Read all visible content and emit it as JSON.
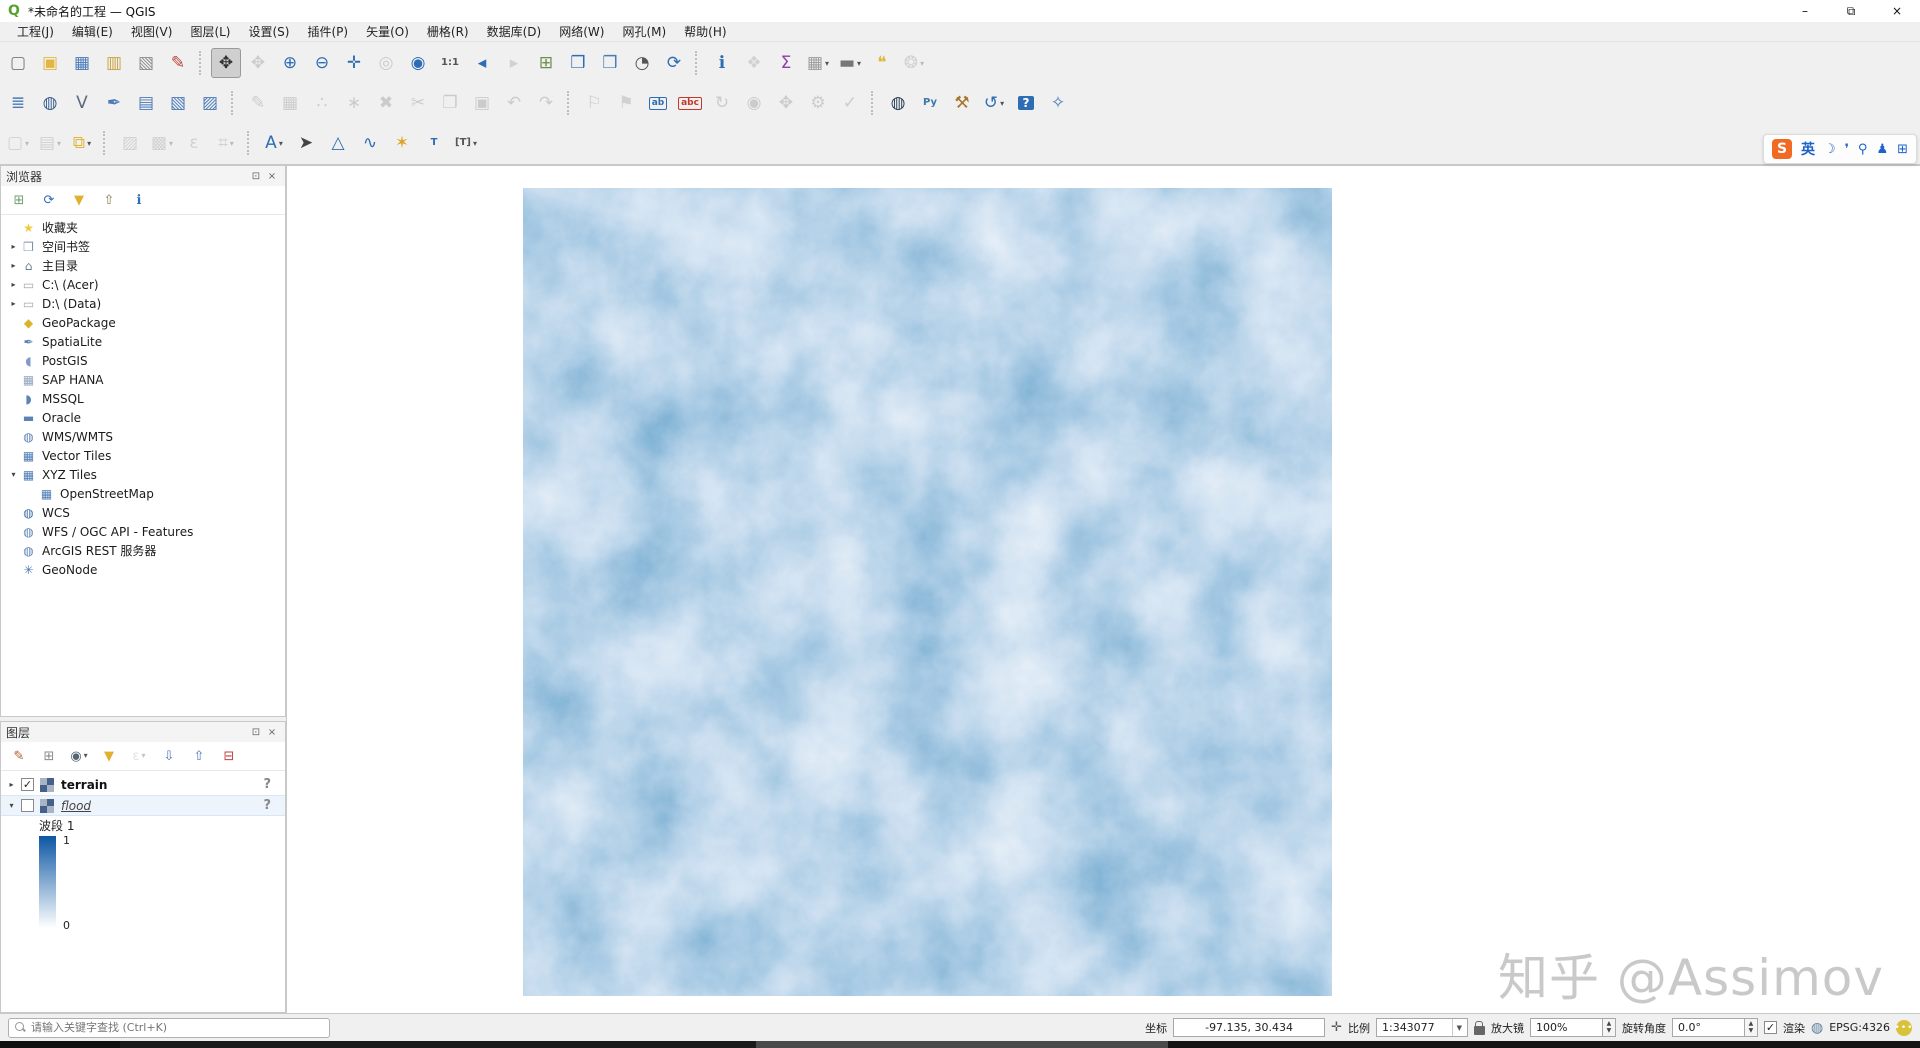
{
  "window": {
    "title": "*未命名的工程 — QGIS",
    "logo": "Q",
    "controls": [
      {
        "n": "minimize-button",
        "g": "–"
      },
      {
        "n": "restore-button",
        "g": "⧉"
      },
      {
        "n": "close-button",
        "g": "×"
      }
    ]
  },
  "menubar": {
    "items": [
      {
        "id": "project",
        "label": "工程(J)"
      },
      {
        "id": "edit",
        "label": "编辑(E)"
      },
      {
        "id": "view",
        "label": "视图(V)"
      },
      {
        "id": "layer",
        "label": "图层(L)"
      },
      {
        "id": "settings",
        "label": "设置(S)"
      },
      {
        "id": "plugins",
        "label": "插件(P)"
      },
      {
        "id": "vector",
        "label": "矢量(O)"
      },
      {
        "id": "raster",
        "label": "栅格(R)"
      },
      {
        "id": "database",
        "label": "数据库(D)"
      },
      {
        "id": "web",
        "label": "网络(W)"
      },
      {
        "id": "mesh",
        "label": "网孔(M)"
      },
      {
        "id": "help",
        "label": "帮助(H)"
      }
    ]
  },
  "toolbars": {
    "rows": [
      [
        {
          "n": "new-project",
          "g": "▢",
          "c": "#777777"
        },
        {
          "n": "open-project",
          "g": "▣",
          "c": "#e3b642"
        },
        {
          "n": "save-project",
          "g": "▦",
          "c": "#4a7ab8"
        },
        {
          "n": "new-print-layout",
          "g": "▥",
          "c": "#c9a23e"
        },
        {
          "n": "show-layout-manager",
          "g": "▧",
          "c": "#8a8a8a"
        },
        {
          "n": "style-manager",
          "g": "✎",
          "c": "#b8443a"
        },
        {
          "sep": true
        },
        {
          "n": "pan-map",
          "g": "✥",
          "c": "#333333",
          "sel": true
        },
        {
          "n": "pan-to-selection",
          "g": "✥",
          "c": "#888888",
          "dis": true
        },
        {
          "n": "zoom-in",
          "g": "⊕",
          "c": "#2e6db4"
        },
        {
          "n": "zoom-out",
          "g": "⊖",
          "c": "#2e6db4"
        },
        {
          "n": "zoom-full",
          "g": "✛",
          "c": "#2e6db4"
        },
        {
          "n": "zoom-to-selection",
          "g": "◎",
          "c": "#888888",
          "dis": true
        },
        {
          "n": "zoom-to-layer",
          "g": "◉",
          "c": "#2e6db4"
        },
        {
          "n": "zoom-native-resolution",
          "g": "1:1",
          "c": "#555555",
          "t": true
        },
        {
          "n": "zoom-last",
          "g": "◂",
          "c": "#2e6db4"
        },
        {
          "n": "zoom-next",
          "g": "▸",
          "c": "#999999",
          "dis": true
        },
        {
          "n": "new-map-view",
          "g": "⊞",
          "c": "#6f8f4f"
        },
        {
          "n": "new-spatial-bookmark",
          "g": "❒",
          "c": "#2e6db4"
        },
        {
          "n": "show-spatial-bookmarks",
          "g": "❒",
          "c": "#4a7ab8"
        },
        {
          "n": "temporal-controller",
          "g": "◔",
          "c": "#555555"
        },
        {
          "n": "refresh-map",
          "g": "⟳",
          "c": "#2e6db4"
        },
        {
          "sep": true
        },
        {
          "n": "identify-features",
          "g": "ℹ",
          "c": "#2e6db4"
        },
        {
          "n": "run-feature-action",
          "g": "❖",
          "c": "#999999",
          "dis": true
        },
        {
          "n": "show-statistical-summary",
          "g": "Σ",
          "c": "#8e3fa8"
        },
        {
          "n": "open-attribute-table",
          "g": "▦",
          "c": "#9a9a9a",
          "dd": true
        },
        {
          "n": "measure-line",
          "g": "▬",
          "c": "#777777",
          "dd": true
        },
        {
          "n": "map-tips",
          "g": "❝",
          "c": "#e0b63a"
        },
        {
          "n": "new-annotation",
          "g": "❂",
          "c": "#999999",
          "dis": true,
          "dd": true
        }
      ],
      [
        {
          "n": "open-data-source-manager",
          "g": "≣",
          "c": "#4a7ab8"
        },
        {
          "n": "new-geopackage-layer",
          "g": "◍",
          "c": "#3a5f8f"
        },
        {
          "n": "new-shapefile-layer",
          "g": "V",
          "c": "#5b6b7b"
        },
        {
          "n": "new-spatialite-layer",
          "g": "✒",
          "c": "#4a7ab8"
        },
        {
          "n": "new-virtual-layer",
          "g": "▤",
          "c": "#4a7ab8"
        },
        {
          "n": "new-mesh-layer",
          "g": "▧",
          "c": "#4a7ab8"
        },
        {
          "n": "new-temporary-scratch-layer",
          "g": "▨",
          "c": "#4a7ab8"
        },
        {
          "sep": true
        },
        {
          "n": "toggle-editing",
          "g": "✎",
          "c": "#888888",
          "dis": true
        },
        {
          "n": "save-layer-edits",
          "g": "▦",
          "c": "#888888",
          "dis": true
        },
        {
          "n": "add-feature",
          "g": "∴",
          "c": "#888888",
          "dis": true
        },
        {
          "n": "vertex-tool",
          "g": "∗",
          "c": "#888888",
          "dis": true
        },
        {
          "n": "delete-selected",
          "g": "✖",
          "c": "#888888",
          "dis": true
        },
        {
          "n": "cut-features",
          "g": "✂",
          "c": "#888888",
          "dis": true
        },
        {
          "n": "copy-features",
          "g": "❐",
          "c": "#888888",
          "dis": true
        },
        {
          "n": "paste-features",
          "g": "▣",
          "c": "#888888",
          "dis": true
        },
        {
          "n": "undo",
          "g": "↶",
          "c": "#888888",
          "dis": true
        },
        {
          "n": "redo",
          "g": "↷",
          "c": "#888888",
          "dis": true
        },
        {
          "sep": true
        },
        {
          "n": "pin-labels",
          "g": "⚐",
          "c": "#888888",
          "dis": true
        },
        {
          "n": "highlight-pinned-labels",
          "g": "⚑",
          "c": "#999999",
          "dis": true
        },
        {
          "n": "move-label",
          "g": "ab",
          "c": "#2e6db4",
          "t": true,
          "box": "blueline"
        },
        {
          "n": "change-label",
          "g": "abc",
          "c": "#c0392b",
          "t": true,
          "box": "red"
        },
        {
          "n": "rotate-label",
          "g": "↻",
          "c": "#888888",
          "dis": true
        },
        {
          "n": "show-hide-labels",
          "g": "◉",
          "c": "#888888",
          "dis": true
        },
        {
          "n": "move-label-diagram",
          "g": "✥",
          "c": "#888888",
          "dis": true
        },
        {
          "n": "label-properties",
          "g": "⚙",
          "c": "#888888",
          "dis": true
        },
        {
          "n": "diagram-properties",
          "g": "✓",
          "c": "#888888",
          "dis": true
        },
        {
          "sep": true
        },
        {
          "n": "osm-place-search",
          "g": "◍",
          "c": "#2a3f55"
        },
        {
          "n": "python-console",
          "g": "Py",
          "c": "#3c78aa",
          "t": true
        },
        {
          "n": "processing-toolbox",
          "g": "⚒",
          "c": "#a8762a"
        },
        {
          "n": "processing-history",
          "g": "↺",
          "c": "#2e6db4",
          "dd": true
        },
        {
          "n": "help-contents",
          "g": "?",
          "c": "#ffffff",
          "t": true,
          "box": "bluefill"
        },
        {
          "n": "georeferencer",
          "g": "✧",
          "c": "#4a7ab8"
        }
      ],
      [
        {
          "n": "select-features",
          "g": "▢",
          "c": "#999999",
          "dis": true,
          "dd": true
        },
        {
          "n": "select-by-value",
          "g": "▤",
          "c": "#999999",
          "dis": true,
          "dd": true
        },
        {
          "n": "deselect-all",
          "g": "⧉",
          "c": "#e0b63a",
          "dd": true
        },
        {
          "sep": true
        },
        {
          "n": "field-calculator",
          "g": "▨",
          "c": "#999999",
          "dis": true
        },
        {
          "n": "multi-edit-attributes",
          "g": "▩",
          "c": "#999999",
          "dis": true,
          "dd": true
        },
        {
          "n": "edit-metadata",
          "g": "ε",
          "c": "#999999",
          "dis": true
        },
        {
          "n": "raster-tools",
          "g": "⌗",
          "c": "#999999",
          "dis": true,
          "dd": true
        },
        {
          "sep": true
        },
        {
          "n": "layer-labeling-options",
          "g": "A",
          "c": "#2e6db4",
          "dd": true
        },
        {
          "n": "move-annotation-tool",
          "g": "➤",
          "c": "#444444"
        },
        {
          "n": "new-polygon-annotation",
          "g": "△",
          "c": "#2e6db4"
        },
        {
          "n": "new-line-annotation",
          "g": "∿",
          "c": "#2e6db4"
        },
        {
          "n": "new-marker-annotation",
          "g": "✶",
          "c": "#d9a62a"
        },
        {
          "n": "new-text-annotation",
          "g": "T",
          "c": "#2e6db4",
          "t": true
        },
        {
          "n": "balloon-text-annotation",
          "g": "[T]",
          "c": "#555555",
          "t": true,
          "dd": true
        }
      ]
    ]
  },
  "browser_panel": {
    "title": "浏览器",
    "toolbar": [
      {
        "n": "add-selected-layers",
        "g": "⊞",
        "c": "#6f9f6f"
      },
      {
        "n": "refresh-browser",
        "g": "⟳",
        "c": "#2e6db4"
      },
      {
        "n": "filter-browser",
        "g": "▼",
        "c": "#e0b030"
      },
      {
        "n": "collapse-all",
        "g": "⇧",
        "c": "#8a7a4a"
      },
      {
        "n": "show-properties-widget",
        "g": "ℹ",
        "c": "#2e6db4"
      }
    ],
    "tree": [
      {
        "id": "favorites",
        "label": "收藏夹",
        "icon": "star-icon",
        "g": "★",
        "c": "#f3c93c",
        "arrow": ""
      },
      {
        "id": "spatial-bookmarks",
        "label": "空间书签",
        "icon": "bookmark-icon",
        "g": "❒",
        "c": "#7d93ad",
        "arrow": "▸"
      },
      {
        "id": "home",
        "label": "主目录",
        "icon": "home-icon",
        "g": "⌂",
        "c": "#6b7f95",
        "arrow": "▸"
      },
      {
        "id": "drive-c",
        "label": "C:\\ (Acer)",
        "icon": "folder-icon",
        "g": "▭",
        "c": "#a8a8a8",
        "arrow": "▸"
      },
      {
        "id": "drive-d",
        "label": "D:\\ (Data)",
        "icon": "folder-icon",
        "g": "▭",
        "c": "#a8a8a8",
        "arrow": "▸"
      },
      {
        "id": "geopackage",
        "label": "GeoPackage",
        "icon": "geopackage-icon",
        "g": "◆",
        "c": "#d9b32a",
        "arrow": ""
      },
      {
        "id": "spatialite",
        "label": "SpatiaLite",
        "icon": "spatialite-icon",
        "g": "✒",
        "c": "#5b84b5",
        "arrow": ""
      },
      {
        "id": "postgis",
        "label": "PostGIS",
        "icon": "postgis-icon",
        "g": "◖",
        "c": "#7d9cc9",
        "arrow": ""
      },
      {
        "id": "sap-hana",
        "label": "SAP HANA",
        "icon": "sap-hana-icon",
        "g": "▦",
        "c": "#8fa5bd",
        "arrow": ""
      },
      {
        "id": "mssql",
        "label": "MSSQL",
        "icon": "mssql-icon",
        "g": "◗",
        "c": "#5b84b5",
        "arrow": ""
      },
      {
        "id": "oracle",
        "label": "Oracle",
        "icon": "oracle-icon",
        "g": "▬",
        "c": "#5b84b5",
        "arrow": ""
      },
      {
        "id": "wms-wmts",
        "label": "WMS/WMTS",
        "icon": "globe-icon",
        "g": "◍",
        "c": "#5b84b5",
        "arrow": ""
      },
      {
        "id": "vector-tiles",
        "label": "Vector Tiles",
        "icon": "tiles-icon",
        "g": "▦",
        "c": "#4a7ab5",
        "arrow": ""
      },
      {
        "id": "xyz-tiles",
        "label": "XYZ Tiles",
        "icon": "tiles-icon",
        "g": "▦",
        "c": "#4a7ab5",
        "arrow": "▾"
      },
      {
        "id": "openstreetmap",
        "label": "OpenStreetMap",
        "icon": "tiles-icon",
        "g": "▦",
        "c": "#4a7ab5",
        "arrow": "",
        "indent": 1
      },
      {
        "id": "wcs",
        "label": "WCS",
        "icon": "globe-icon",
        "g": "◍",
        "c": "#3d6fa8",
        "arrow": ""
      },
      {
        "id": "wfs",
        "label": "WFS / OGC API - Features",
        "icon": "globe-icon",
        "g": "◍",
        "c": "#5b84b5",
        "arrow": ""
      },
      {
        "id": "arcgis-rest",
        "label": "ArcGIS REST 服务器",
        "icon": "globe-icon",
        "g": "◍",
        "c": "#5b84b5",
        "arrow": ""
      },
      {
        "id": "geonode",
        "label": "GeoNode",
        "icon": "geonode-icon",
        "g": "✳",
        "c": "#4a7ab5",
        "arrow": ""
      }
    ]
  },
  "layers_panel": {
    "title": "图层",
    "toolbar": [
      {
        "n": "open-layer-styling-panel",
        "g": "✎",
        "c": "#b05a2a"
      },
      {
        "n": "add-group",
        "g": "⊞",
        "c": "#8a8a8a"
      },
      {
        "n": "manage-map-themes",
        "g": "◉",
        "c": "#556677",
        "dd": true
      },
      {
        "n": "filter-legend",
        "g": "▼",
        "c": "#e0b030"
      },
      {
        "n": "filter-by-expression",
        "g": "ε",
        "c": "#aaaaaa",
        "dis": true,
        "dd": true
      },
      {
        "n": "expand-all",
        "g": "⇩",
        "c": "#4a7ab8"
      },
      {
        "n": "collapse-all-layers",
        "g": "⇧",
        "c": "#4a7ab8"
      },
      {
        "n": "remove-layer",
        "g": "⊟",
        "c": "#c04040"
      }
    ],
    "layers": [
      {
        "id": "terrain",
        "name": "terrain",
        "checked": true,
        "bold": true,
        "arrow": "▸",
        "badge": "?"
      },
      {
        "id": "flood",
        "name": "flood",
        "checked": false,
        "italic": true,
        "selected": true,
        "arrow": "▾",
        "badge": "?"
      }
    ],
    "legend": {
      "band": "波段 1",
      "max": "1",
      "min": "0",
      "top_color": "#0d57a3",
      "bottom_color": "#ffffff"
    }
  },
  "statusbar": {
    "search_placeholder": "请输入关键字查找 (Ctrl+K)",
    "coord_label": "坐标",
    "coord_value": "-97.135, 30.434",
    "scale_label": "比例",
    "scale_value": "1:343077",
    "magnifier_label": "放大镜",
    "magnifier_value": "100%",
    "rotation_label": "旋转角度",
    "rotation_value": "0.0°",
    "render_label": "渲染",
    "crs": "EPSG:4326"
  },
  "map": {
    "background": "#ffffff",
    "palette": {
      "r": "0.07 0.20 0.40 0.62 0.80 0.91",
      "g": "0.29 0.44 0.60 0.75 0.87 0.94",
      "b": "0.52 0.66 0.78 0.88 0.94 0.97"
    }
  },
  "watermark": {
    "text": "知乎 @Assimov"
  },
  "input_method": {
    "logo": "S",
    "mode": "英",
    "icons": [
      {
        "n": "night-mode-icon",
        "g": "☽"
      },
      {
        "n": "punctuation-icon",
        "g": "❜"
      },
      {
        "n": "mic-icon",
        "g": "⚲"
      },
      {
        "n": "person-icon",
        "g": "♟"
      },
      {
        "n": "grid-icon",
        "g": "⊞"
      }
    ]
  },
  "colors": {
    "accent": "#2e6db4",
    "toolbar_bg": "#f0f0f0",
    "selection_bg": "#edf4fc"
  }
}
